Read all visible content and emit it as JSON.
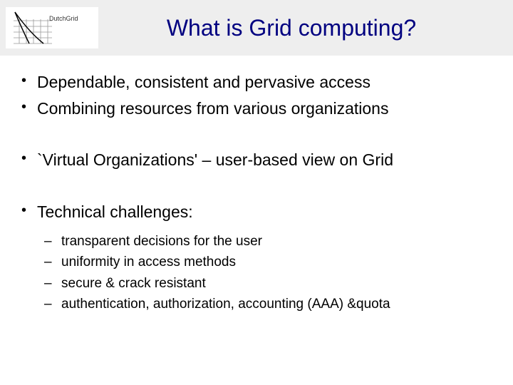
{
  "logo_text": "DutchGrid",
  "title": "What is Grid computing?",
  "bullets": [
    {
      "text": "Dependable, consistent and pervasive access"
    },
    {
      "text": "Combining resources from various organizations"
    },
    {
      "text": "`Virtual Organizations' – user-based view on Grid"
    },
    {
      "text": "Technical challenges:"
    }
  ],
  "sub_bullets": [
    "transparent decisions for the user",
    "uniformity in access methods",
    "secure & crack resistant",
    "authentication, authorization, accounting (AAA) &quota"
  ]
}
